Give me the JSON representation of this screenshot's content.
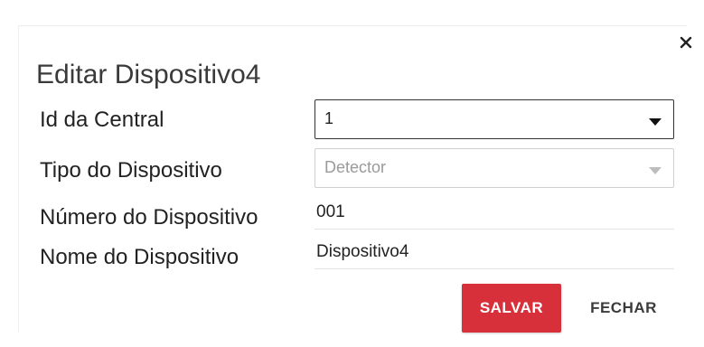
{
  "dialog": {
    "title": "Editar Dispositivo4",
    "close_icon": "close-icon",
    "fields": {
      "central_id": {
        "label": "Id da Central",
        "value": "1"
      },
      "device_type": {
        "label": "Tipo do Dispositivo",
        "value": "Detector",
        "disabled": true
      },
      "device_number": {
        "label": "Número do Dispositivo",
        "value": "001"
      },
      "device_name": {
        "label": "Nome do Dispositivo",
        "value": "Dispositivo4"
      }
    },
    "buttons": {
      "save_label": "SALVAR",
      "close_label": "FECHAR"
    },
    "colors": {
      "save_button": "#d7303b",
      "title_text": "#3a3a3a"
    }
  }
}
